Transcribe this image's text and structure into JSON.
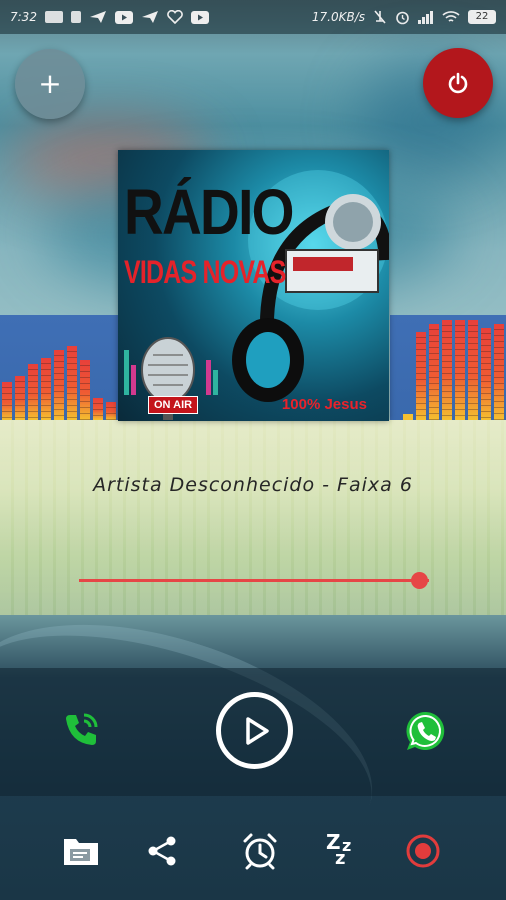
{
  "status_bar": {
    "time": "7:32",
    "network_speed": "17.0KB/s",
    "battery": "22",
    "icons": [
      "gallery-icon",
      "sim-icon",
      "send-icon",
      "youtube-icon",
      "send-icon",
      "heart-icon",
      "youtube-icon",
      "mute-icon",
      "alarm-icon",
      "signal-icon",
      "wifi-icon",
      "battery-icon"
    ]
  },
  "header": {
    "add_button_label": "+",
    "power_icon": "power-icon",
    "power_color": "#b3171c"
  },
  "cover": {
    "title": "RÁDIO",
    "subtitle": "VIDAS NOVAS",
    "badge": "ON AIR",
    "tagline": "100% Jesus"
  },
  "player": {
    "track_title": "Artista Desconhecido - Faixa 6",
    "volume_fraction": 0.97,
    "accent_color": "#e64646"
  },
  "controls": {
    "call_icon": "phone-call-icon",
    "play_icon": "play-icon",
    "whatsapp_icon": "whatsapp-icon",
    "call_color": "#1fbf3a",
    "whatsapp_color": "#1fbf3a"
  },
  "toolbar": {
    "items": [
      "folder-icon",
      "share-icon",
      "alarm-clock-icon",
      "sleep-timer-icon",
      "record-icon"
    ],
    "sleep_text": "Zzz",
    "record_color": "#e23c3c"
  }
}
